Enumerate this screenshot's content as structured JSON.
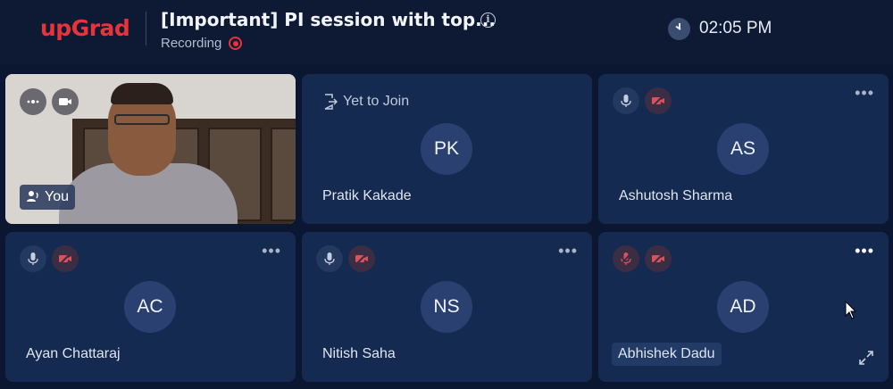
{
  "header": {
    "logo": "upGrad",
    "title": "[Important] PI session with top...",
    "info_icon": "info-icon",
    "recording_label": "Recording",
    "time": "02:05 PM"
  },
  "self_tile": {
    "label": "You",
    "icons": [
      "speaker-icon",
      "video-camera-icon"
    ]
  },
  "participants": [
    {
      "initials": "PK",
      "name": "Pratik Kakade",
      "status": "Yet to Join"
    },
    {
      "initials": "AS",
      "name": "Ashutosh Sharma",
      "mic": "on",
      "camera": "off"
    },
    {
      "initials": "AC",
      "name": "Ayan Chattaraj",
      "mic": "on",
      "camera": "off"
    },
    {
      "initials": "NS",
      "name": "Nitish Saha",
      "mic": "on",
      "camera": "off"
    },
    {
      "initials": "AD",
      "name": "Abhishek Dadu",
      "mic": "muted",
      "camera": "off"
    }
  ],
  "colors": {
    "brand": "#e8323c",
    "background": "#0b1730",
    "tile": "#152a50"
  }
}
